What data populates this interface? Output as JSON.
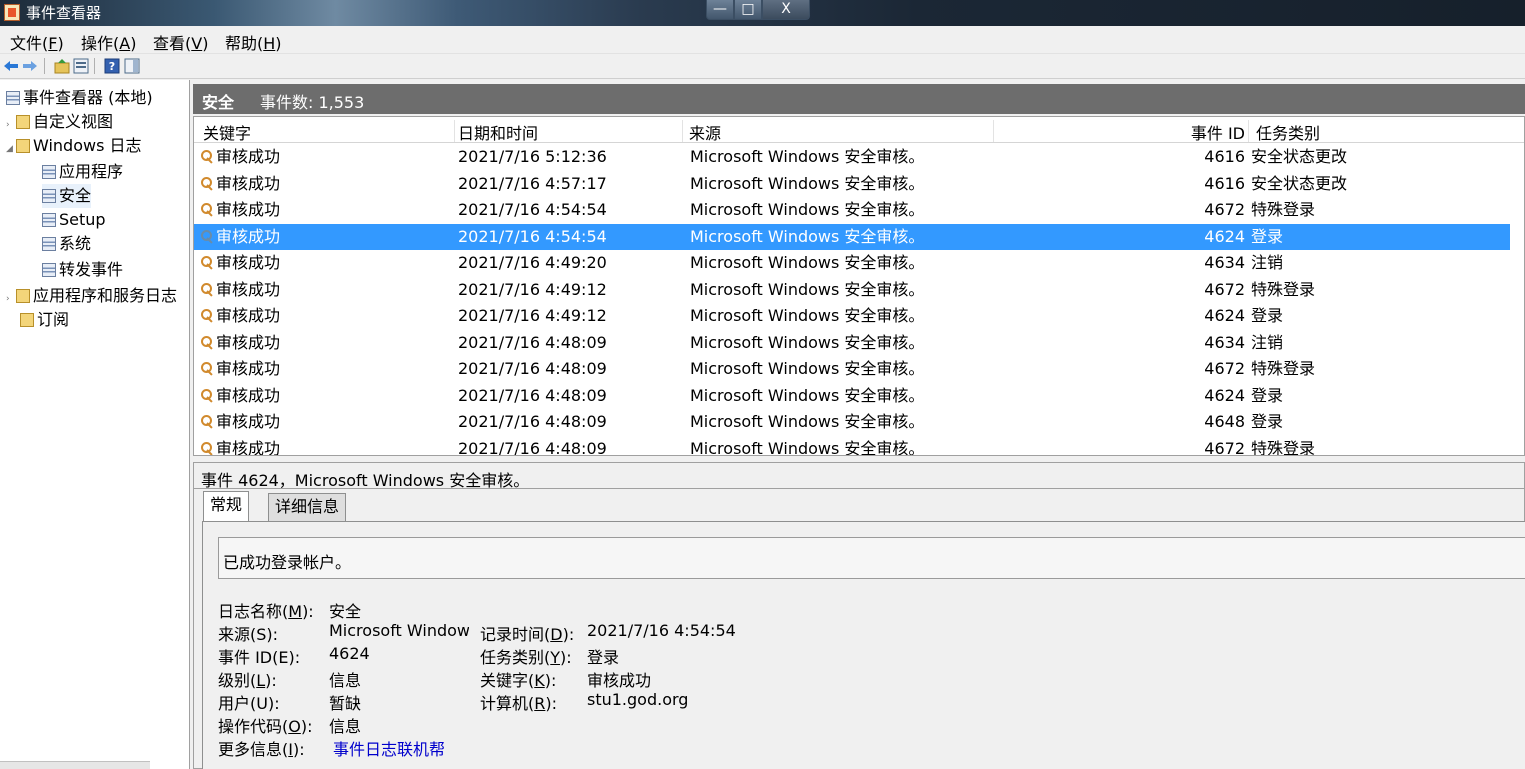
{
  "window": {
    "title": "事件查看器",
    "min": "—",
    "max": "□",
    "close": "X"
  },
  "menu": [
    {
      "label": "文件(",
      "key": "F",
      "end": ")"
    },
    {
      "label": "操作(",
      "key": "A",
      "end": ")"
    },
    {
      "label": "查看(",
      "key": "V",
      "end": ")"
    },
    {
      "label": "帮助(",
      "key": "H",
      "end": ")"
    }
  ],
  "toolbar": {
    "back_icon": "arrow-left-icon",
    "forward_icon": "arrow-right-icon",
    "up_icon": "folder-up-icon",
    "properties_icon": "properties-icon",
    "help_icon": "help-icon",
    "show_pane_icon": "pane-icon"
  },
  "tree": [
    {
      "label": "事件查看器 (本地)",
      "arrow": "",
      "level": 0
    },
    {
      "label": "自定义视图",
      "arrow": "›",
      "level": 1
    },
    {
      "label": "Windows 日志",
      "arrow": "◢",
      "level": 1
    },
    {
      "label": "应用程序",
      "arrow": "",
      "level": 2
    },
    {
      "label": "安全",
      "arrow": "",
      "level": 2,
      "selected": true
    },
    {
      "label": "Setup",
      "arrow": "",
      "level": 2
    },
    {
      "label": "系统",
      "arrow": "",
      "level": 2
    },
    {
      "label": "转发事件",
      "arrow": "",
      "level": 2
    },
    {
      "label": "应用程序和服务日志",
      "arrow": "›",
      "level": 1
    },
    {
      "label": "订阅",
      "arrow": "",
      "level": 1
    }
  ],
  "log_header": {
    "name": "安全",
    "count": "事件数: 1,553"
  },
  "table": {
    "columns": [
      "关键字",
      "日期和时间",
      "来源",
      "事件 ID",
      "任务类别"
    ],
    "rows": [
      {
        "keyword": "审核成功",
        "datetime": "2021/7/16 5:12:36",
        "source": "Microsoft Windows 安全审核。",
        "event_id": "4616",
        "category": "安全状态更改"
      },
      {
        "keyword": "审核成功",
        "datetime": "2021/7/16 4:57:17",
        "source": "Microsoft Windows 安全审核。",
        "event_id": "4616",
        "category": "安全状态更改"
      },
      {
        "keyword": "审核成功",
        "datetime": "2021/7/16 4:54:54",
        "source": "Microsoft Windows 安全审核。",
        "event_id": "4672",
        "category": "特殊登录"
      },
      {
        "keyword": "审核成功",
        "datetime": "2021/7/16 4:54:54",
        "source": "Microsoft Windows 安全审核。",
        "event_id": "4624",
        "category": "登录",
        "selected": true
      },
      {
        "keyword": "审核成功",
        "datetime": "2021/7/16 4:49:20",
        "source": "Microsoft Windows 安全审核。",
        "event_id": "4634",
        "category": "注销"
      },
      {
        "keyword": "审核成功",
        "datetime": "2021/7/16 4:49:12",
        "source": "Microsoft Windows 安全审核。",
        "event_id": "4672",
        "category": "特殊登录"
      },
      {
        "keyword": "审核成功",
        "datetime": "2021/7/16 4:49:12",
        "source": "Microsoft Windows 安全审核。",
        "event_id": "4624",
        "category": "登录"
      },
      {
        "keyword": "审核成功",
        "datetime": "2021/7/16 4:48:09",
        "source": "Microsoft Windows 安全审核。",
        "event_id": "4634",
        "category": "注销"
      },
      {
        "keyword": "审核成功",
        "datetime": "2021/7/16 4:48:09",
        "source": "Microsoft Windows 安全审核。",
        "event_id": "4672",
        "category": "特殊登录"
      },
      {
        "keyword": "审核成功",
        "datetime": "2021/7/16 4:48:09",
        "source": "Microsoft Windows 安全审核。",
        "event_id": "4624",
        "category": "登录"
      },
      {
        "keyword": "审核成功",
        "datetime": "2021/7/16 4:48:09",
        "source": "Microsoft Windows 安全审核。",
        "event_id": "4648",
        "category": "登录"
      },
      {
        "keyword": "审核成功",
        "datetime": "2021/7/16 4:48:09",
        "source": "Microsoft Windows 安全审核。",
        "event_id": "4672",
        "category": "特殊登录"
      }
    ]
  },
  "detail": {
    "title": "事件 4624，Microsoft Windows 安全审核。",
    "tabs": [
      "常规",
      "详细信息"
    ],
    "message": "已成功登录帐户。",
    "log_name_label": "日志名称(",
    "log_name_key": "M",
    "log_name_end": "):",
    "log_name": "安全",
    "source_label": "来源(S):",
    "source": "Microsoft Windows security auditing.",
    "record_time_label": "记录时间(",
    "record_time_key": "D",
    "record_time_end": "):",
    "record_time": "2021/7/16 4:54:54",
    "event_id_label": "事件 ID(E):",
    "event_id": "4624",
    "task_category_label": "任务类别(",
    "task_category_key": "Y",
    "task_category_end": "):",
    "task_category": "登录",
    "level_label": "级别(",
    "level_key": "L",
    "level_end": "):",
    "level": "信息",
    "keywords_label": "关键字(",
    "keywords_key": "K",
    "keywords_end": "):",
    "keywords": "审核成功",
    "user_label": "用户(U):",
    "user": "暂缺",
    "computer_label": "计算机(",
    "computer_key": "R",
    "computer_end": "):",
    "computer": "stu1.god.org",
    "opcode_label": "操作代码(",
    "opcode_key": "O",
    "opcode_end": "):",
    "opcode": "信息",
    "more_info_label": "更多信息(",
    "more_info_key": "I",
    "more_info_end": "):",
    "more_info_link": "事件日志联机帮"
  },
  "colors": {
    "selection": "#3399ff",
    "header_bar": "#6d6d6d",
    "link": "#0000cc"
  }
}
